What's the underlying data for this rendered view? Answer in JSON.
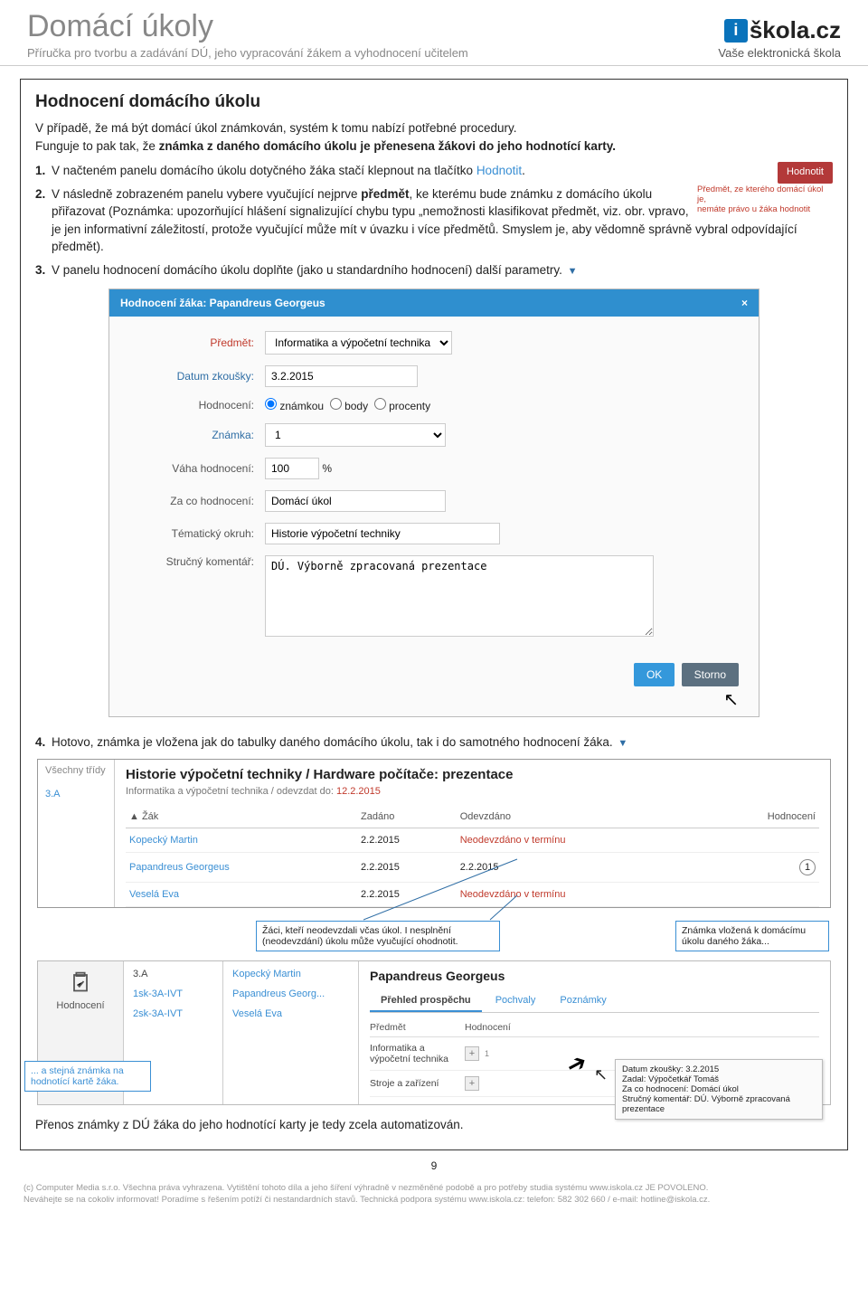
{
  "header": {
    "title": "Domácí úkoly",
    "subtitle": "Příručka pro tvorbu a zadávání DÚ, jeho vypracování žákem a vyhodnocení učitelem",
    "logo_i": "i",
    "logo_text": "škola.cz",
    "logo_tagline": "Vaše elektronická škola"
  },
  "section": {
    "heading": "Hodnocení domácího úkolu",
    "intro1": "V případě, že má být domácí úkol známkován, systém k tomu nabízí potřebné procedury.",
    "intro2_a": "Funguje to pak tak, že ",
    "intro2_b": "známka z daného domácího úkolu je přenesena žákovi do jeho hodnotící karty.",
    "li1_a": "V načteném panelu domácího úkolu dotyčného žáka stačí klepnout na tlačítko ",
    "li1_link": "Hodnotit",
    "li1_dot": ".",
    "btn_hodnotit": "Hodnotit",
    "li2_a": "V následně zobrazeném panelu vybere vyučující nejprve ",
    "li2_b": "předmět",
    "li2_c": ", ke kterému bude známku z domácího úkolu přiřazovat (Poznámka: upozorňující hlášení signalizující chybu typu „nemožnosti klasifikovat předmět, viz. obr. vpravo, je jen informativní záležitostí, protože vyučující může mít v úvazku i více předmětů. Smyslem je, aby vědomně správně vybral odpovídající předmět).",
    "warn1": "Předmět, ze kterého domácí úkol je,",
    "warn2": "nemáte právo u žáka hodnotit",
    "li3": "V panelu hodnocení domácího úkolu doplňte (jako u standardního hodnocení) další parametry.",
    "li4": "Hotovo, známka je vložena jak do tabulky daného domácího úkolu, tak i do samotného hodnocení žáka.",
    "arrow_marker": "▼",
    "closing": "Přenos známky z DÚ žáka do jeho hodnotící karty je tedy zcela automatizován."
  },
  "modal": {
    "title": "Hodnocení žáka: Papandreus Georgeus",
    "close": "×",
    "labels": {
      "predmet": "Předmět:",
      "datum": "Datum zkoušky:",
      "hodnoceni": "Hodnocení:",
      "znamka": "Známka:",
      "vaha": "Váha hodnocení:",
      "zaco": "Za co hodnocení:",
      "okruh": "Tématický okruh:",
      "komentar": "Stručný komentář:",
      "pct": "%"
    },
    "values": {
      "predmet": "Informatika a výpočetní technika",
      "datum": "3.2.2015",
      "opt_znamkou": "známkou",
      "opt_body": "body",
      "opt_procenty": "procenty",
      "znamka": "1",
      "vaha": "100",
      "zaco": "Domácí úkol",
      "okruh": "Historie výpočetní techniky",
      "komentar": "DÚ. Výborně zpracovaná prezentace"
    },
    "ok_label": "OK",
    "storno_label": "Storno"
  },
  "table": {
    "side_all": "Všechny třídy",
    "side_class": "3.A",
    "title": "Historie výpočetní techniky / Hardware počítače: prezentace",
    "subject": "Informatika a výpočetní technika / odevzdat do: ",
    "due": "12.2.2015",
    "h_zak": "▲ Žák",
    "h_zadano": "Zadáno",
    "h_odevzdano": "Odevzdáno",
    "h_hodnoceni": "Hodnocení",
    "rows": [
      {
        "name": "Kopecký Martin",
        "zad": "2.2.2015",
        "ode": "Neodevzdáno v termínu",
        "neo": true,
        "mark": ""
      },
      {
        "name": "Papandreus Georgeus",
        "zad": "2.2.2015",
        "ode": "2.2.2015",
        "neo": false,
        "mark": "1"
      },
      {
        "name": "Veselá Eva",
        "zad": "2.2.2015",
        "ode": "Neodevzdáno v termínu",
        "neo": true,
        "mark": ""
      }
    ],
    "callout1": "Žáci, kteří neodevzdali včas úkol. I nesplnění (neodevzdání) úkolu může vyučující ohodnotit.",
    "callout2": "Známka vložená k domácímu úkolu daného žáka..."
  },
  "shot2": {
    "icon_label": "Hodnocení",
    "class": "3.A",
    "navs": [
      "1sk-3A-IVT",
      "2sk-3A-IVT"
    ],
    "students": [
      "Kopecký Martin",
      "Papandreus Georg...",
      "Veselá Eva"
    ],
    "main_title": "Papandreus Georgeus",
    "tab_active": "Přehled prospěchu",
    "tab2": "Pochvaly",
    "tab3": "Poznámky",
    "col1": "Předmět",
    "col2": "Hodnocení",
    "subj1": "Informatika a výpočetní technika",
    "subj2": "Stroje a zařízení",
    "plus": "+",
    "mark_val": "1",
    "tip1": "Datum zkoušky: 3.2.2015",
    "tip2": "Zadal: Výpočetkář Tomáš",
    "tip3": "Za co hodnocení: Domácí úkol",
    "tip4": "Stručný komentář: DÚ. Výborně zpracovaná prezentace",
    "callout_left": "... a stejná známka na hodnotící kartě žáka."
  },
  "pagenum": "9",
  "footer": {
    "line1": "(c) Computer Media s.r.o. Všechna práva vyhrazena. Vytištění tohoto díla a jeho šíření výhradně v nezměněné podobě a pro potřeby studia systému www.iskola.cz JE POVOLENO.",
    "line2": "Neváhejte se na cokoliv informovat! Poradíme s řešením potíží či nestandardních stavů. Technická podpora systému www.iskola.cz: telefon: 582 302 660 / e-mail: hotline@iskola.cz."
  }
}
